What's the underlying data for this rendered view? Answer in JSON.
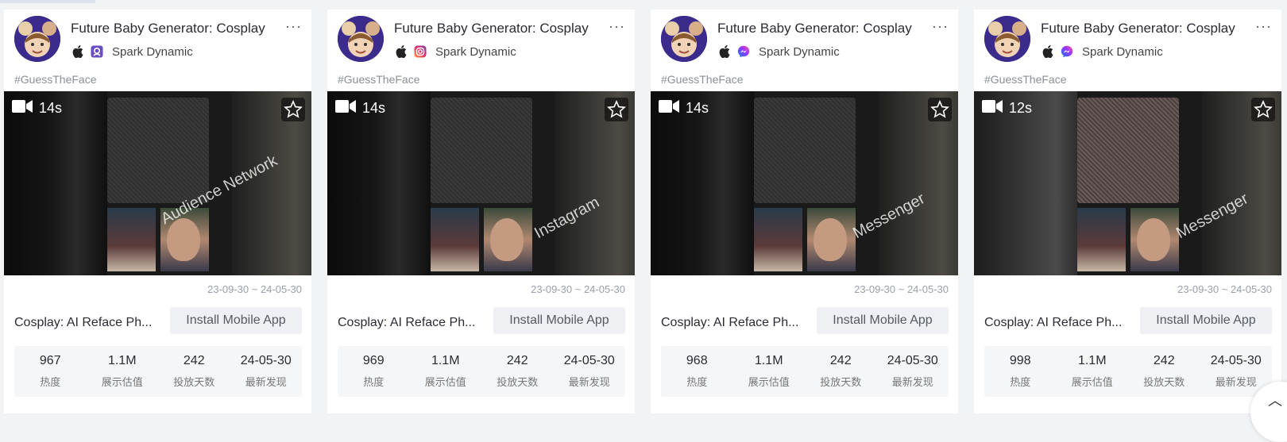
{
  "cards": [
    {
      "title": "Future Baby Generator: Cosplay",
      "developer": "Spark Dynamic",
      "platform_icon": "audience-network-icon",
      "hashtag": "#GuessTheFace",
      "duration": "14s",
      "watermark": "Audience Network",
      "date_range": "23-09-30 ~ 24-05-30",
      "app_name": "Cosplay: AI Reface Ph...",
      "install_label": "Install Mobile App",
      "stats": [
        {
          "value": "967",
          "label": "热度"
        },
        {
          "value": "1.1M",
          "label": "展示估值"
        },
        {
          "value": "242",
          "label": "投放天数"
        },
        {
          "value": "24-05-30",
          "label": "最新发现"
        }
      ]
    },
    {
      "title": "Future Baby Generator: Cosplay",
      "developer": "Spark Dynamic",
      "platform_icon": "instagram-icon",
      "hashtag": "#GuessTheFace",
      "duration": "14s",
      "watermark": "Instagram",
      "date_range": "23-09-30 ~ 24-05-30",
      "app_name": "Cosplay: AI Reface Ph...",
      "install_label": "Install Mobile App",
      "stats": [
        {
          "value": "969",
          "label": "热度"
        },
        {
          "value": "1.1M",
          "label": "展示估值"
        },
        {
          "value": "242",
          "label": "投放天数"
        },
        {
          "value": "24-05-30",
          "label": "最新发现"
        }
      ]
    },
    {
      "title": "Future Baby Generator: Cosplay",
      "developer": "Spark Dynamic",
      "platform_icon": "messenger-icon",
      "hashtag": "#GuessTheFace",
      "duration": "14s",
      "watermark": "Messenger",
      "date_range": "23-09-30 ~ 24-05-30",
      "app_name": "Cosplay: AI Reface Ph...",
      "install_label": "Install Mobile App",
      "stats": [
        {
          "value": "968",
          "label": "热度"
        },
        {
          "value": "1.1M",
          "label": "展示估值"
        },
        {
          "value": "242",
          "label": "投放天数"
        },
        {
          "value": "24-05-30",
          "label": "最新发现"
        }
      ]
    },
    {
      "title": "Future Baby Generator: Cosplay",
      "developer": "Spark Dynamic",
      "platform_icon": "messenger-icon",
      "hashtag": "#GuessTheFace",
      "duration": "12s",
      "watermark": "Messenger",
      "date_range": "23-09-30 ~ 24-05-30",
      "app_name": "Cosplay: AI Reface Ph...",
      "install_label": "Install Mobile App",
      "stats": [
        {
          "value": "998",
          "label": "热度"
        },
        {
          "value": "1.1M",
          "label": "展示估值"
        },
        {
          "value": "242",
          "label": "投放天数"
        },
        {
          "value": "24-05-30",
          "label": "最新发现"
        }
      ]
    }
  ]
}
